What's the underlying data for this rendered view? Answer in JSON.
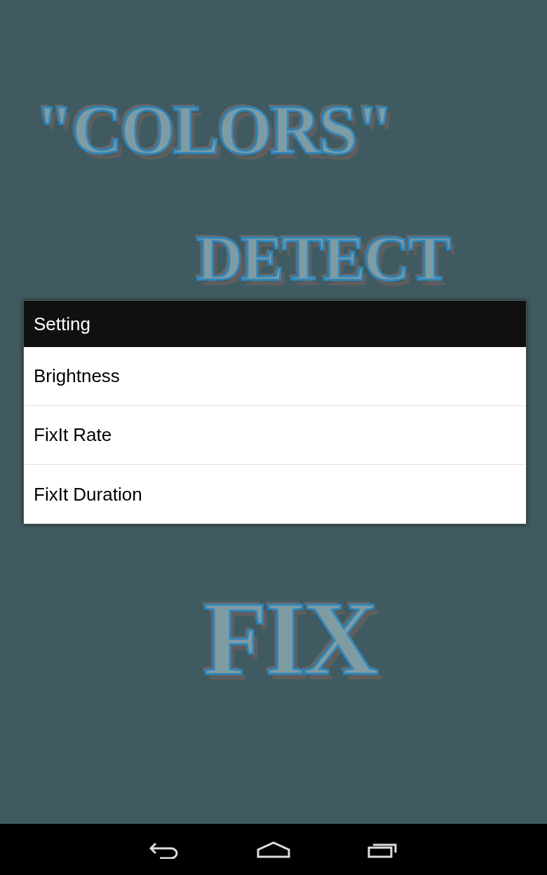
{
  "background_logo": [
    "\"COLORS\"",
    "DETECT",
    "FIX"
  ],
  "dialog": {
    "title": "Setting",
    "items": [
      {
        "label": "Brightness"
      },
      {
        "label": "FixIt Rate"
      },
      {
        "label": "FixIt Duration"
      }
    ]
  },
  "navigation_bar": {
    "buttons": [
      {
        "kind": "back"
      },
      {
        "kind": "home"
      },
      {
        "kind": "recents"
      }
    ]
  }
}
